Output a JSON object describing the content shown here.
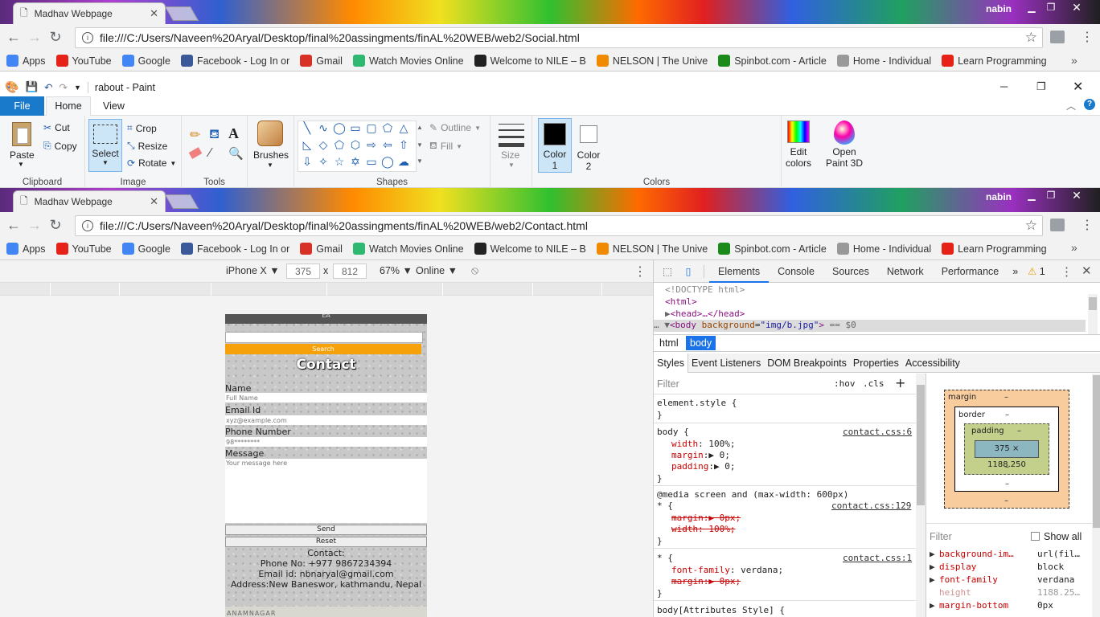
{
  "browser": {
    "tab_title": "Madhav Webpage",
    "user": "nabin",
    "url_top": "file:///C:/Users/Naveen%20Aryal/Desktop/final%20assingments/finAL%20WEB/web2/Social.html",
    "url_bottom": "file:///C:/Users/Naveen%20Aryal/Desktop/final%20assingments/finAL%20WEB/web2/Contact.html",
    "bookmarks": [
      {
        "label": "Apps",
        "icon": "apps-icon",
        "color": "#4285f4"
      },
      {
        "label": "YouTube",
        "icon": "youtube-icon",
        "color": "#e62117"
      },
      {
        "label": "Google",
        "icon": "google-icon",
        "color": "#4285f4"
      },
      {
        "label": "Facebook - Log In or",
        "icon": "facebook-icon",
        "color": "#3b5998"
      },
      {
        "label": "Gmail",
        "icon": "gmail-icon",
        "color": "#d93025"
      },
      {
        "label": "Watch Movies Online",
        "icon": "play-icon",
        "color": "#2eb872"
      },
      {
        "label": "Welcome to NILE – B",
        "icon": "bb-icon",
        "color": "#222222"
      },
      {
        "label": "NELSON | The Unive",
        "icon": "nelson-icon",
        "color": "#f08a00"
      },
      {
        "label": "Spinbot.com - Article",
        "icon": "spinbot-icon",
        "color": "#1a8a1a"
      },
      {
        "label": "Home - Individual",
        "icon": "home-icon",
        "color": "#999999"
      },
      {
        "label": "Learn Programming",
        "icon": "youtube-icon",
        "color": "#e62117"
      }
    ],
    "more_bookmarks": "»"
  },
  "paint": {
    "title": "rabout - Paint",
    "menu": {
      "file": "File",
      "home": "Home",
      "view": "View"
    },
    "clipboard": {
      "paste": "Paste",
      "cut": "Cut",
      "copy": "Copy",
      "label": "Clipboard"
    },
    "image": {
      "select": "Select",
      "crop": "Crop",
      "resize": "Resize",
      "rotate": "Rotate",
      "label": "Image"
    },
    "tools": {
      "label": "Tools"
    },
    "brushes": {
      "label": "Brushes"
    },
    "shapes": {
      "outline": "Outline",
      "fill": "Fill",
      "label": "Shapes"
    },
    "size": {
      "label": "Size"
    },
    "color1": {
      "label": "Color",
      "num": "1",
      "value": "#000000"
    },
    "color2": {
      "label": "Color",
      "num": "2",
      "value": "#ffffff"
    },
    "colors": {
      "label": "Colors"
    },
    "edit_colors": {
      "line1": "Edit",
      "line2": "colors"
    },
    "paint3d": {
      "line1": "Open",
      "line2": "Paint 3D"
    },
    "palette_row1": [
      "#000000",
      "#7f7f7f",
      "#880015",
      "#ed1c24",
      "#ff7f27",
      "#fff200",
      "#22b14c",
      "#00a2e8",
      "#3f48cc",
      "#a349a4"
    ],
    "palette_row2": [
      "#ffffff",
      "#c3c3c3",
      "#b97a57",
      "#ffaec9",
      "#ffc90e",
      "#efe4b0",
      "#b5e61d",
      "#99d9ea",
      "#7092be",
      "#c8bfe7"
    ]
  },
  "device": {
    "model": "iPhone X",
    "width": "375",
    "times": "x",
    "height": "812",
    "zoom": "67%",
    "network": "Online"
  },
  "site": {
    "top_text": "EA",
    "search_btn": "Search",
    "heading": "Contact",
    "name_label": "Name",
    "name_ph": "Full Name",
    "email_label": "Email Id",
    "email_ph": "xyz@example.com",
    "phone_label": "Phone Number",
    "phone_ph": "98********",
    "message_label": "Message",
    "message_ph": "Your message here",
    "send": "Send",
    "reset": "Reset",
    "contact_title": "Contact:",
    "phone": "Phone No: +977 9867234394",
    "email": "Email id: nbnaryal@gmail.com",
    "address": "Address:New Baneswor, kathmandu, Nepal",
    "map_text": "ANAMNAGAR"
  },
  "devtools": {
    "tabs": [
      "Elements",
      "Console",
      "Sources",
      "Network",
      "Performance"
    ],
    "more": "»",
    "warnings": "1",
    "dom": {
      "doctype": "<!DOCTYPE html>",
      "html": "<html>",
      "head": "<head>…</head>",
      "body_tag": "body",
      "body_attr": "background",
      "body_val": "\"img/b.jpg\"",
      "eq": "== $0"
    },
    "breadcrumb": [
      "html",
      "body"
    ],
    "subtabs": [
      "Styles",
      "Event Listeners",
      "DOM Breakpoints",
      "Properties",
      "Accessibility"
    ],
    "filter_ph": "Filter",
    "hov": ":hov",
    "cls": ".cls",
    "rules": {
      "element_style": "element.style {",
      "close": "}",
      "body_sel": "body {",
      "body_src": "contact.css:6",
      "width_prop": "width",
      "width_val": "100%;",
      "margin_prop": "margin",
      "margin_val": "0;",
      "padding_prop": "padding",
      "padding_val": "0;",
      "media": "@media screen and (max-width: 600px)",
      "star_sel": "* {",
      "media_src": "contact.css:129",
      "m_margin": "margin:",
      "m_margin_val": "0px;",
      "m_width": "width: 100%;",
      "star_src": "contact.css:1",
      "ff_prop": "font-family",
      "ff_val": "verdana;",
      "s_margin": "margin:",
      "s_margin_val": "0px;",
      "attr_style": "body[Attributes Style] {"
    },
    "boxmodel": {
      "margin": "margin",
      "border": "border",
      "padding": "padding",
      "dash": "–",
      "content": "375 × 1188.250"
    },
    "computed_filter": "Filter",
    "show_all": "Show all",
    "computed": [
      {
        "prop": "background-im…",
        "val": "url(fil…"
      },
      {
        "prop": "display",
        "val": "block"
      },
      {
        "prop": "font-family",
        "val": "verdana"
      },
      {
        "prop": "height",
        "val": "1188.25…"
      },
      {
        "prop": "margin-bottom",
        "val": "0px"
      }
    ]
  }
}
